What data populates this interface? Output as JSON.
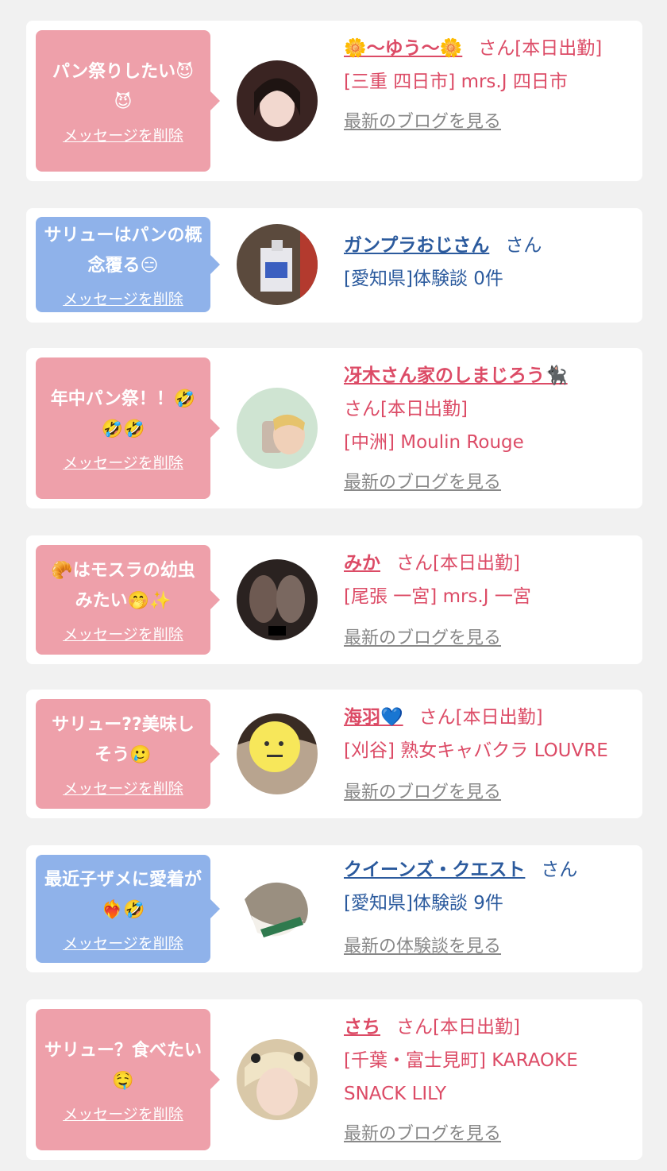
{
  "delete_label": "メッセージを削除",
  "san_label": "さん",
  "cards": [
    {
      "theme": "pink",
      "message": "パン祭りしたい😈😈",
      "name": "🌼〜ゆう〜🌼",
      "status": "[本日出勤]",
      "shop": "[三重 四日市] mrs.J 四日市",
      "link": "最新のブログを見る"
    },
    {
      "theme": "blue",
      "message": "サリューはパンの概念覆る😑",
      "name": "ガンプラおじさん",
      "status": "",
      "shop": "[愛知県]体験談 0件",
      "link": ""
    },
    {
      "theme": "pink",
      "message": "年中パン祭！！🤣🤣🤣",
      "name": "冴木さん家のしまじろう🐈‍⬛",
      "status": "[本日出勤]",
      "shop": "[中洲] Moulin Rouge",
      "link": "最新のブログを見る"
    },
    {
      "theme": "pink",
      "message": "🥐はモスラの幼虫みたい🤭✨",
      "name": "みか",
      "status": "[本日出勤]",
      "shop": "[尾張 一宮] mrs.J 一宮",
      "link": "最新のブログを見る"
    },
    {
      "theme": "pink",
      "message": "サリュー??美味しそう🥲",
      "name": "海羽💙",
      "status": "[本日出勤]",
      "shop": "[刈谷] 熟女キャバクラ LOUVRE",
      "link": "最新のブログを見る"
    },
    {
      "theme": "blue",
      "message": "最近子ザメに愛着が❤️‍🔥🤣",
      "name": "クイーンズ・クエスト",
      "status": "",
      "shop": "[愛知県]体験談 9件",
      "link": "最新の体験談を見る"
    },
    {
      "theme": "pink",
      "message": "サリュー？食べたい🤤",
      "name": "さち",
      "status": "[本日出勤]",
      "shop": "[千葉・富士見町] KARAOKE SNACK LILY",
      "link": "最新のブログを見る"
    }
  ]
}
